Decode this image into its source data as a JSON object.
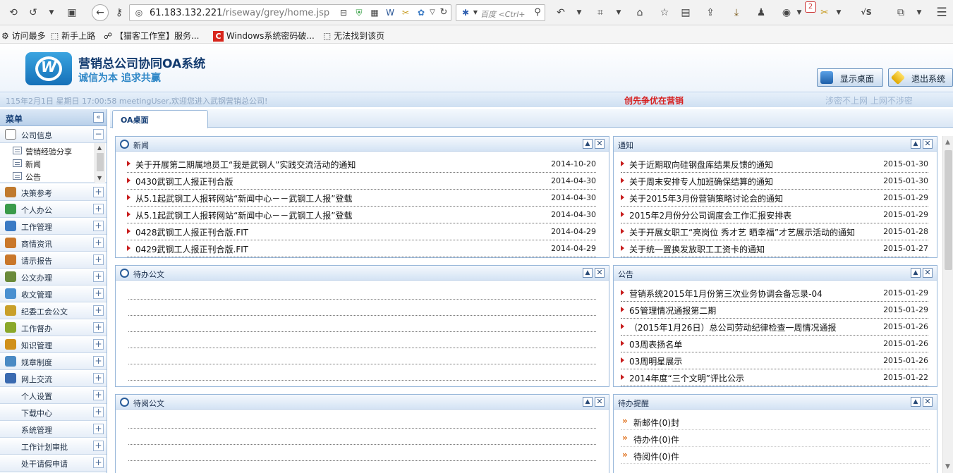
{
  "browser": {
    "url_host": "61.183.132.221",
    "url_path": "/riseway/grey/home.jsp",
    "search_placeholder": "百度 <Ctrl+",
    "badge_count": "2",
    "bookmarks": [
      "访问最多",
      "新手上路",
      "【猫客工作室】服务...",
      "Windows系统密码破...",
      "无法找到该页"
    ]
  },
  "header": {
    "title": "营销总公司协同OA系统",
    "slogan": "诚信为本 追求共赢",
    "show_desktop": "显示桌面",
    "logout": "退出系统"
  },
  "infobar": {
    "date_text": "115年2月1日  星期日    17:00:58        meetingUser,欢迎您进入武钢营销总公司!",
    "center_text": "创先争优在营销",
    "right_text": "涉密不上网    上网不涉密"
  },
  "sidebar": {
    "title": "菜单",
    "collapse_glyph": "«",
    "company_info": "公司信息",
    "sub_items": [
      "营销经验分享",
      "新闻",
      "公告"
    ],
    "items": [
      "决策参考",
      "个人办公",
      "工作管理",
      "商情资讯",
      "请示报告",
      "公文办理",
      "收文管理",
      "纪委工会公文",
      "工作督办",
      "知识管理",
      "规章制度",
      "网上交流",
      "个人设置",
      "下载中心",
      "系统管理",
      "工作计划审批",
      "处干请假申请"
    ]
  },
  "tab": {
    "label": "OA桌面"
  },
  "portlets": {
    "news": {
      "title": "新闻",
      "rows": [
        {
          "text": "关于开展第二期属地员工“我是武钢人”实践交流活动的通知",
          "date": "2014-10-20"
        },
        {
          "text": "0430武钢工人报正刊合版",
          "date": "2014-04-30"
        },
        {
          "text": "从5.1起武钢工人报转网站“新闻中心－－武钢工人报”登载",
          "date": "2014-04-30"
        },
        {
          "text": "从5.1起武钢工人报转网站“新闻中心－－武钢工人报”登载",
          "date": "2014-04-30"
        },
        {
          "text": "0428武钢工人报正刊合版.FIT",
          "date": "2014-04-29"
        },
        {
          "text": "0429武钢工人报正刊合版.FIT",
          "date": "2014-04-29"
        }
      ]
    },
    "notice": {
      "title": "通知",
      "rows": [
        {
          "text": "关于近期取向硅钢盘库结果反馈的通知",
          "date": "2015-01-30"
        },
        {
          "text": "关于周末安排专人加班确保结算的通知",
          "date": "2015-01-30"
        },
        {
          "text": "关于2015年3月份营销策略讨论会的通知",
          "date": "2015-01-29"
        },
        {
          "text": "2015年2月份分公司调度会工作汇报安排表",
          "date": "2015-01-29"
        },
        {
          "text": "关于开展女职工“亮岗位 秀才艺 晒幸福”才艺展示活动的通知",
          "date": "2015-01-28"
        },
        {
          "text": "关于统一置换发放职工工资卡的通知",
          "date": "2015-01-27"
        }
      ]
    },
    "pending_docs": {
      "title": "待办公文"
    },
    "announcement": {
      "title": "公告",
      "rows": [
        {
          "text": "营销系统2015年1月份第三次业务协调会备忘录-04",
          "date": "2015-01-29"
        },
        {
          "text": "65管理情况通报第二期",
          "date": "2015-01-29"
        },
        {
          "text": "（2015年1月26日）总公司劳动纪律检查一周情况通报",
          "date": "2015-01-26"
        },
        {
          "text": "03周表扬名单",
          "date": "2015-01-26"
        },
        {
          "text": "03周明星展示",
          "date": "2015-01-26"
        },
        {
          "text": "2014年度“三个文明”评比公示",
          "date": "2015-01-22"
        }
      ]
    },
    "to_read": {
      "title": "待阅公文"
    },
    "reminder": {
      "title": "待办提醒",
      "rows": [
        "新邮件(0)封",
        "待办件(0)件",
        "待阅件(0)件"
      ]
    }
  },
  "colors": {
    "accent": "#163f76",
    "alert": "#d61f1f",
    "border": "#99b8da"
  }
}
